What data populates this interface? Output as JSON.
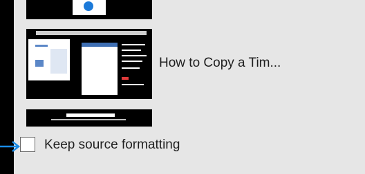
{
  "list": {
    "items": [
      {
        "caption": ""
      },
      {
        "caption": "How to Copy a Tim..."
      },
      {
        "caption": ""
      }
    ]
  },
  "options": {
    "keep_source_label": "Keep source formatting",
    "keep_source_checked": false
  },
  "colors": {
    "panel_bg": "#e6e6e6",
    "pointer_arrow": "#1a8ce8"
  },
  "icons": {
    "pointer": "arrow-right-icon"
  }
}
